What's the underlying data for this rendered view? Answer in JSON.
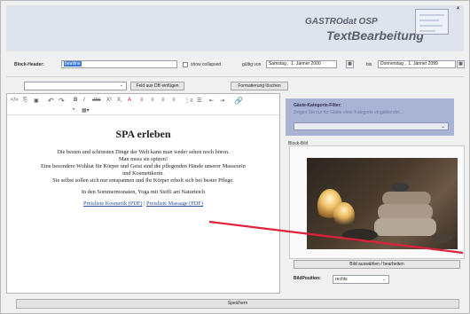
{
  "header": {
    "brand_line1": "GASTROdat OSP",
    "brand_line2": "TextBearbeitung",
    "close_label": "×"
  },
  "block_header": {
    "label": "Block-Header:",
    "value": "beatline",
    "show_collapsed_label": "show collapsed",
    "gueltig_von_label": "gültig von",
    "von_day": "Samstag",
    "von_date": "1.   Jänner  2000",
    "bis_label": "bis",
    "bis_day": "Donnerstag",
    "bis_date": "1.   Jänner  2099"
  },
  "actions": {
    "feld_einfuegen": "Feld aus DB einfügen",
    "formatierung_loeschen": "Formatierung löschen"
  },
  "editor": {
    "toolbar": [
      "↶",
      "⎘",
      "↷",
      "B",
      "I",
      "abc",
      "X²",
      "X₂",
      "A",
      "≡",
      "≡",
      "≡",
      "≡",
      "☰",
      "☰",
      "⇤",
      "⇥",
      "🔗"
    ],
    "heading": "SPA erleben",
    "p1": "Die besten und schönsten Dinge der Welt kann man weder sehen noch hören.",
    "p2": "Man muss sie spüren!",
    "p3": "Eine besondere Wohltat für Körper und Geist sind die pflegenden Hände unserer Masseurin",
    "p4": "und Kosmetikerin.",
    "p5": "Sie selbst sollen sich nur entspannen und Ihr Körper erholt sich bei bester Pflege.",
    "p6": "In den Sommermonaten, Yoga mit Steffi am Naturteich",
    "link1": "Preisliste Kosmetik (PDF)",
    "link_sep": " | ",
    "link2": "Preisliste Massage (PDF)"
  },
  "filter": {
    "title": "Gäste-Kategorie-Filter:",
    "hint": "Zeigen Sie nur für Gäste einer Kategorie eingeblendet..."
  },
  "bild": {
    "label": "Block-Bild",
    "select_button": "Bild auswählen / bearbeiten",
    "position_label": "BildPosition:",
    "position_value": "rechts"
  },
  "save_button": "Speichern",
  "colors": {
    "header_bg": "#dfe3ec",
    "filter_bg": "#a9b3d4",
    "link": "#2a4ea0",
    "arrow": "#e0203a"
  }
}
